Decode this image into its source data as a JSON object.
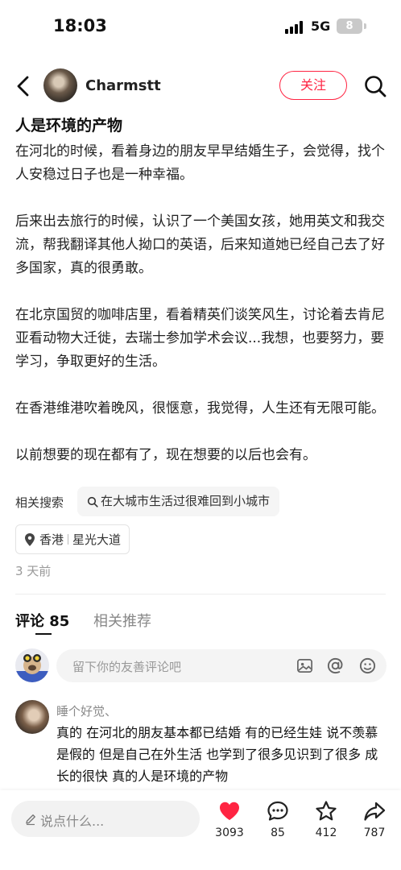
{
  "status_bar": {
    "time": "18:03",
    "network": "5G",
    "battery": "8"
  },
  "header": {
    "username": "Charmstt",
    "follow_label": "关注"
  },
  "post": {
    "title": "人是环境的产物",
    "paragraphs": [
      "在河北的时候，看着身边的朋友早早结婚生子，会觉得，找个人安稳过日子也是一种幸福。",
      "后来出去旅行的时候，认识了一个美国女孩，她用英文和我交流，帮我翻译其他人拗口的英语，后来知道她已经自己去了好多国家，真的很勇敢。",
      "在北京国贸的咖啡店里，看着精英们谈笑风生，讨论着去肯尼亚看动物大迁徙，去瑞士参加学术会议...我想，也要努力，要学习，争取更好的生活。",
      "在香港维港吹着晚风，很惬意，我觉得，人生还有无限可能。",
      "以前想要的现在都有了，现在想要的以后也会有。"
    ],
    "related_label": "相关搜索",
    "related_query": "在大城市生活过很难回到小城市",
    "location": {
      "city": "香港",
      "place": "星光大道"
    },
    "date": "3 天前"
  },
  "comments_section": {
    "tab_comments": "评论 85",
    "tab_related": "相关推荐",
    "input_placeholder": "留下你的友善评论吧",
    "comment": {
      "author": "睡个好觉、",
      "text": "真的 在河北的朋友基本都已结婚 有的已经生娃 说不羡慕是假的 但是自己在外生活 也学到了很多见识到了很多 成长的很快 真的人是环境的产物"
    }
  },
  "bottom_bar": {
    "say_placeholder": "说点什么...",
    "likes": "3093",
    "comments": "85",
    "stars": "412",
    "shares": "787",
    "like_color": "#ff2442"
  }
}
